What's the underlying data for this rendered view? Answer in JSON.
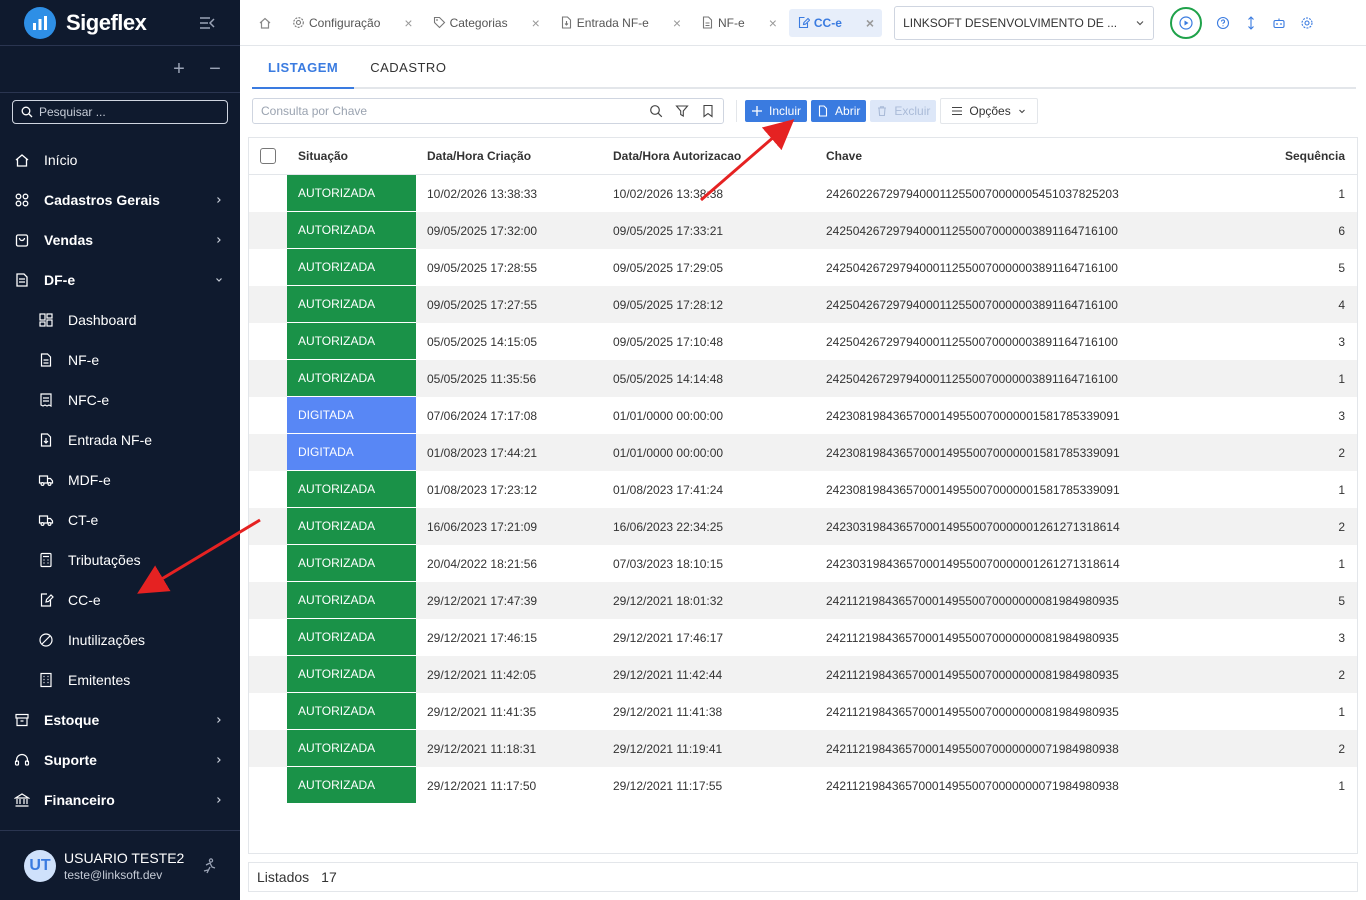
{
  "app": {
    "name": "Sigeflex",
    "search_placeholder": "Pesquisar ..."
  },
  "sidebar": {
    "items": [
      {
        "label": "Início",
        "icon": "home-icon",
        "bold": false
      },
      {
        "label": "Cadastros Gerais",
        "icon": "grid-icon",
        "bold": true,
        "chevron": "right"
      },
      {
        "label": "Vendas",
        "icon": "bag-icon",
        "bold": true,
        "chevron": "right"
      },
      {
        "label": "DF-e",
        "icon": "document-icon",
        "bold": true,
        "chevron": "down"
      },
      {
        "label": "Dashboard",
        "icon": "dashboard-icon",
        "sub": true
      },
      {
        "label": "NF-e",
        "icon": "file-icon",
        "sub": true
      },
      {
        "label": "NFC-e",
        "icon": "receipt-icon",
        "sub": true
      },
      {
        "label": "Entrada NF-e",
        "icon": "file-in-icon",
        "sub": true
      },
      {
        "label": "MDF-e",
        "icon": "truck-icon",
        "sub": true
      },
      {
        "label": "CT-e",
        "icon": "truck-icon",
        "sub": true
      },
      {
        "label": "Tributações",
        "icon": "calculator-icon",
        "sub": true
      },
      {
        "label": "CC-e",
        "icon": "edit-file-icon",
        "sub": true
      },
      {
        "label": "Inutilizações",
        "icon": "block-icon",
        "sub": true
      },
      {
        "label": "Emitentes",
        "icon": "building-icon",
        "sub": true
      },
      {
        "label": "Estoque",
        "icon": "box-icon",
        "bold": true,
        "chevron": "right"
      },
      {
        "label": "Suporte",
        "icon": "headset-icon",
        "bold": true,
        "chevron": "right"
      },
      {
        "label": "Financeiro",
        "icon": "bank-icon",
        "bold": true,
        "chevron": "right"
      }
    ]
  },
  "user": {
    "initials": "UT",
    "name": "USUARIO TESTE2",
    "email": "teste@linksoft.dev"
  },
  "tabs": [
    {
      "label": "Configuração",
      "icon": "gear-icon",
      "active": false
    },
    {
      "label": "Categorias",
      "icon": "tag-icon",
      "active": false
    },
    {
      "label": "Entrada NF-e",
      "icon": "file-in-icon",
      "active": false
    },
    {
      "label": "NF-e",
      "icon": "file-icon",
      "active": false
    },
    {
      "label": "CC-e",
      "icon": "edit-file-icon",
      "active": true
    }
  ],
  "company": "LINKSOFT DESENVOLVIMENTO DE ...",
  "subtabs": [
    "LISTAGEM",
    "CADASTRO"
  ],
  "toolbar": {
    "search_placeholder": "Consulta por Chave",
    "incluir": "Incluir",
    "abrir": "Abrir",
    "excluir": "Excluir",
    "opcoes": "Opções"
  },
  "table": {
    "headers": [
      "Situação",
      "Data/Hora Criação",
      "Data/Hora Autorizacao",
      "Chave",
      "Sequência"
    ],
    "rows": [
      {
        "situacao": "AUTORIZADA",
        "criacao": "10/02/2026 13:38:33",
        "autorizacao": "10/02/2026 13:38:38",
        "chave": "24260226729794000112550070000005451037825203",
        "seq": "1"
      },
      {
        "situacao": "AUTORIZADA",
        "criacao": "09/05/2025 17:32:00",
        "autorizacao": "09/05/2025 17:33:21",
        "chave": "24250426729794000112550070000003891164716100",
        "seq": "6"
      },
      {
        "situacao": "AUTORIZADA",
        "criacao": "09/05/2025 17:28:55",
        "autorizacao": "09/05/2025 17:29:05",
        "chave": "24250426729794000112550070000003891164716100",
        "seq": "5"
      },
      {
        "situacao": "AUTORIZADA",
        "criacao": "09/05/2025 17:27:55",
        "autorizacao": "09/05/2025 17:28:12",
        "chave": "24250426729794000112550070000003891164716100",
        "seq": "4"
      },
      {
        "situacao": "AUTORIZADA",
        "criacao": "05/05/2025 14:15:05",
        "autorizacao": "09/05/2025 17:10:48",
        "chave": "24250426729794000112550070000003891164716100",
        "seq": "3"
      },
      {
        "situacao": "AUTORIZADA",
        "criacao": "05/05/2025 11:35:56",
        "autorizacao": "05/05/2025 14:14:48",
        "chave": "24250426729794000112550070000003891164716100",
        "seq": "1"
      },
      {
        "situacao": "DIGITADA",
        "criacao": "07/06/2024 17:17:08",
        "autorizacao": "01/01/0000 00:00:00",
        "chave": "24230819843657000149550070000001581785339091",
        "seq": "3"
      },
      {
        "situacao": "DIGITADA",
        "criacao": "01/08/2023 17:44:21",
        "autorizacao": "01/01/0000 00:00:00",
        "chave": "24230819843657000149550070000001581785339091",
        "seq": "2"
      },
      {
        "situacao": "AUTORIZADA",
        "criacao": "01/08/2023 17:23:12",
        "autorizacao": "01/08/2023 17:41:24",
        "chave": "24230819843657000149550070000001581785339091",
        "seq": "1"
      },
      {
        "situacao": "AUTORIZADA",
        "criacao": "16/06/2023 17:21:09",
        "autorizacao": "16/06/2023 22:34:25",
        "chave": "24230319843657000149550070000001261271318614",
        "seq": "2"
      },
      {
        "situacao": "AUTORIZADA",
        "criacao": "20/04/2022 18:21:56",
        "autorizacao": "07/03/2023 18:10:15",
        "chave": "24230319843657000149550070000001261271318614",
        "seq": "1"
      },
      {
        "situacao": "AUTORIZADA",
        "criacao": "29/12/2021 17:47:39",
        "autorizacao": "29/12/2021 18:01:32",
        "chave": "24211219843657000149550070000000081984980935",
        "seq": "5"
      },
      {
        "situacao": "AUTORIZADA",
        "criacao": "29/12/2021 17:46:15",
        "autorizacao": "29/12/2021 17:46:17",
        "chave": "24211219843657000149550070000000081984980935",
        "seq": "3"
      },
      {
        "situacao": "AUTORIZADA",
        "criacao": "29/12/2021 11:42:05",
        "autorizacao": "29/12/2021 11:42:44",
        "chave": "24211219843657000149550070000000081984980935",
        "seq": "2"
      },
      {
        "situacao": "AUTORIZADA",
        "criacao": "29/12/2021 11:41:35",
        "autorizacao": "29/12/2021 11:41:38",
        "chave": "24211219843657000149550070000000081984980935",
        "seq": "1"
      },
      {
        "situacao": "AUTORIZADA",
        "criacao": "29/12/2021 11:18:31",
        "autorizacao": "29/12/2021 11:19:41",
        "chave": "24211219843657000149550070000000071984980938",
        "seq": "2"
      },
      {
        "situacao": "AUTORIZADA",
        "criacao": "29/12/2021 11:17:50",
        "autorizacao": "29/12/2021 11:17:55",
        "chave": "24211219843657000149550070000000071984980938",
        "seq": "1"
      }
    ]
  },
  "footer": {
    "label": "Listados",
    "count": "17"
  },
  "colors": {
    "sidebar_bg": "#0f1a2e",
    "accent": "#3a7be0",
    "autorizada": "#1a9248",
    "digitada": "#5887f5",
    "arrow": "#e52222"
  }
}
